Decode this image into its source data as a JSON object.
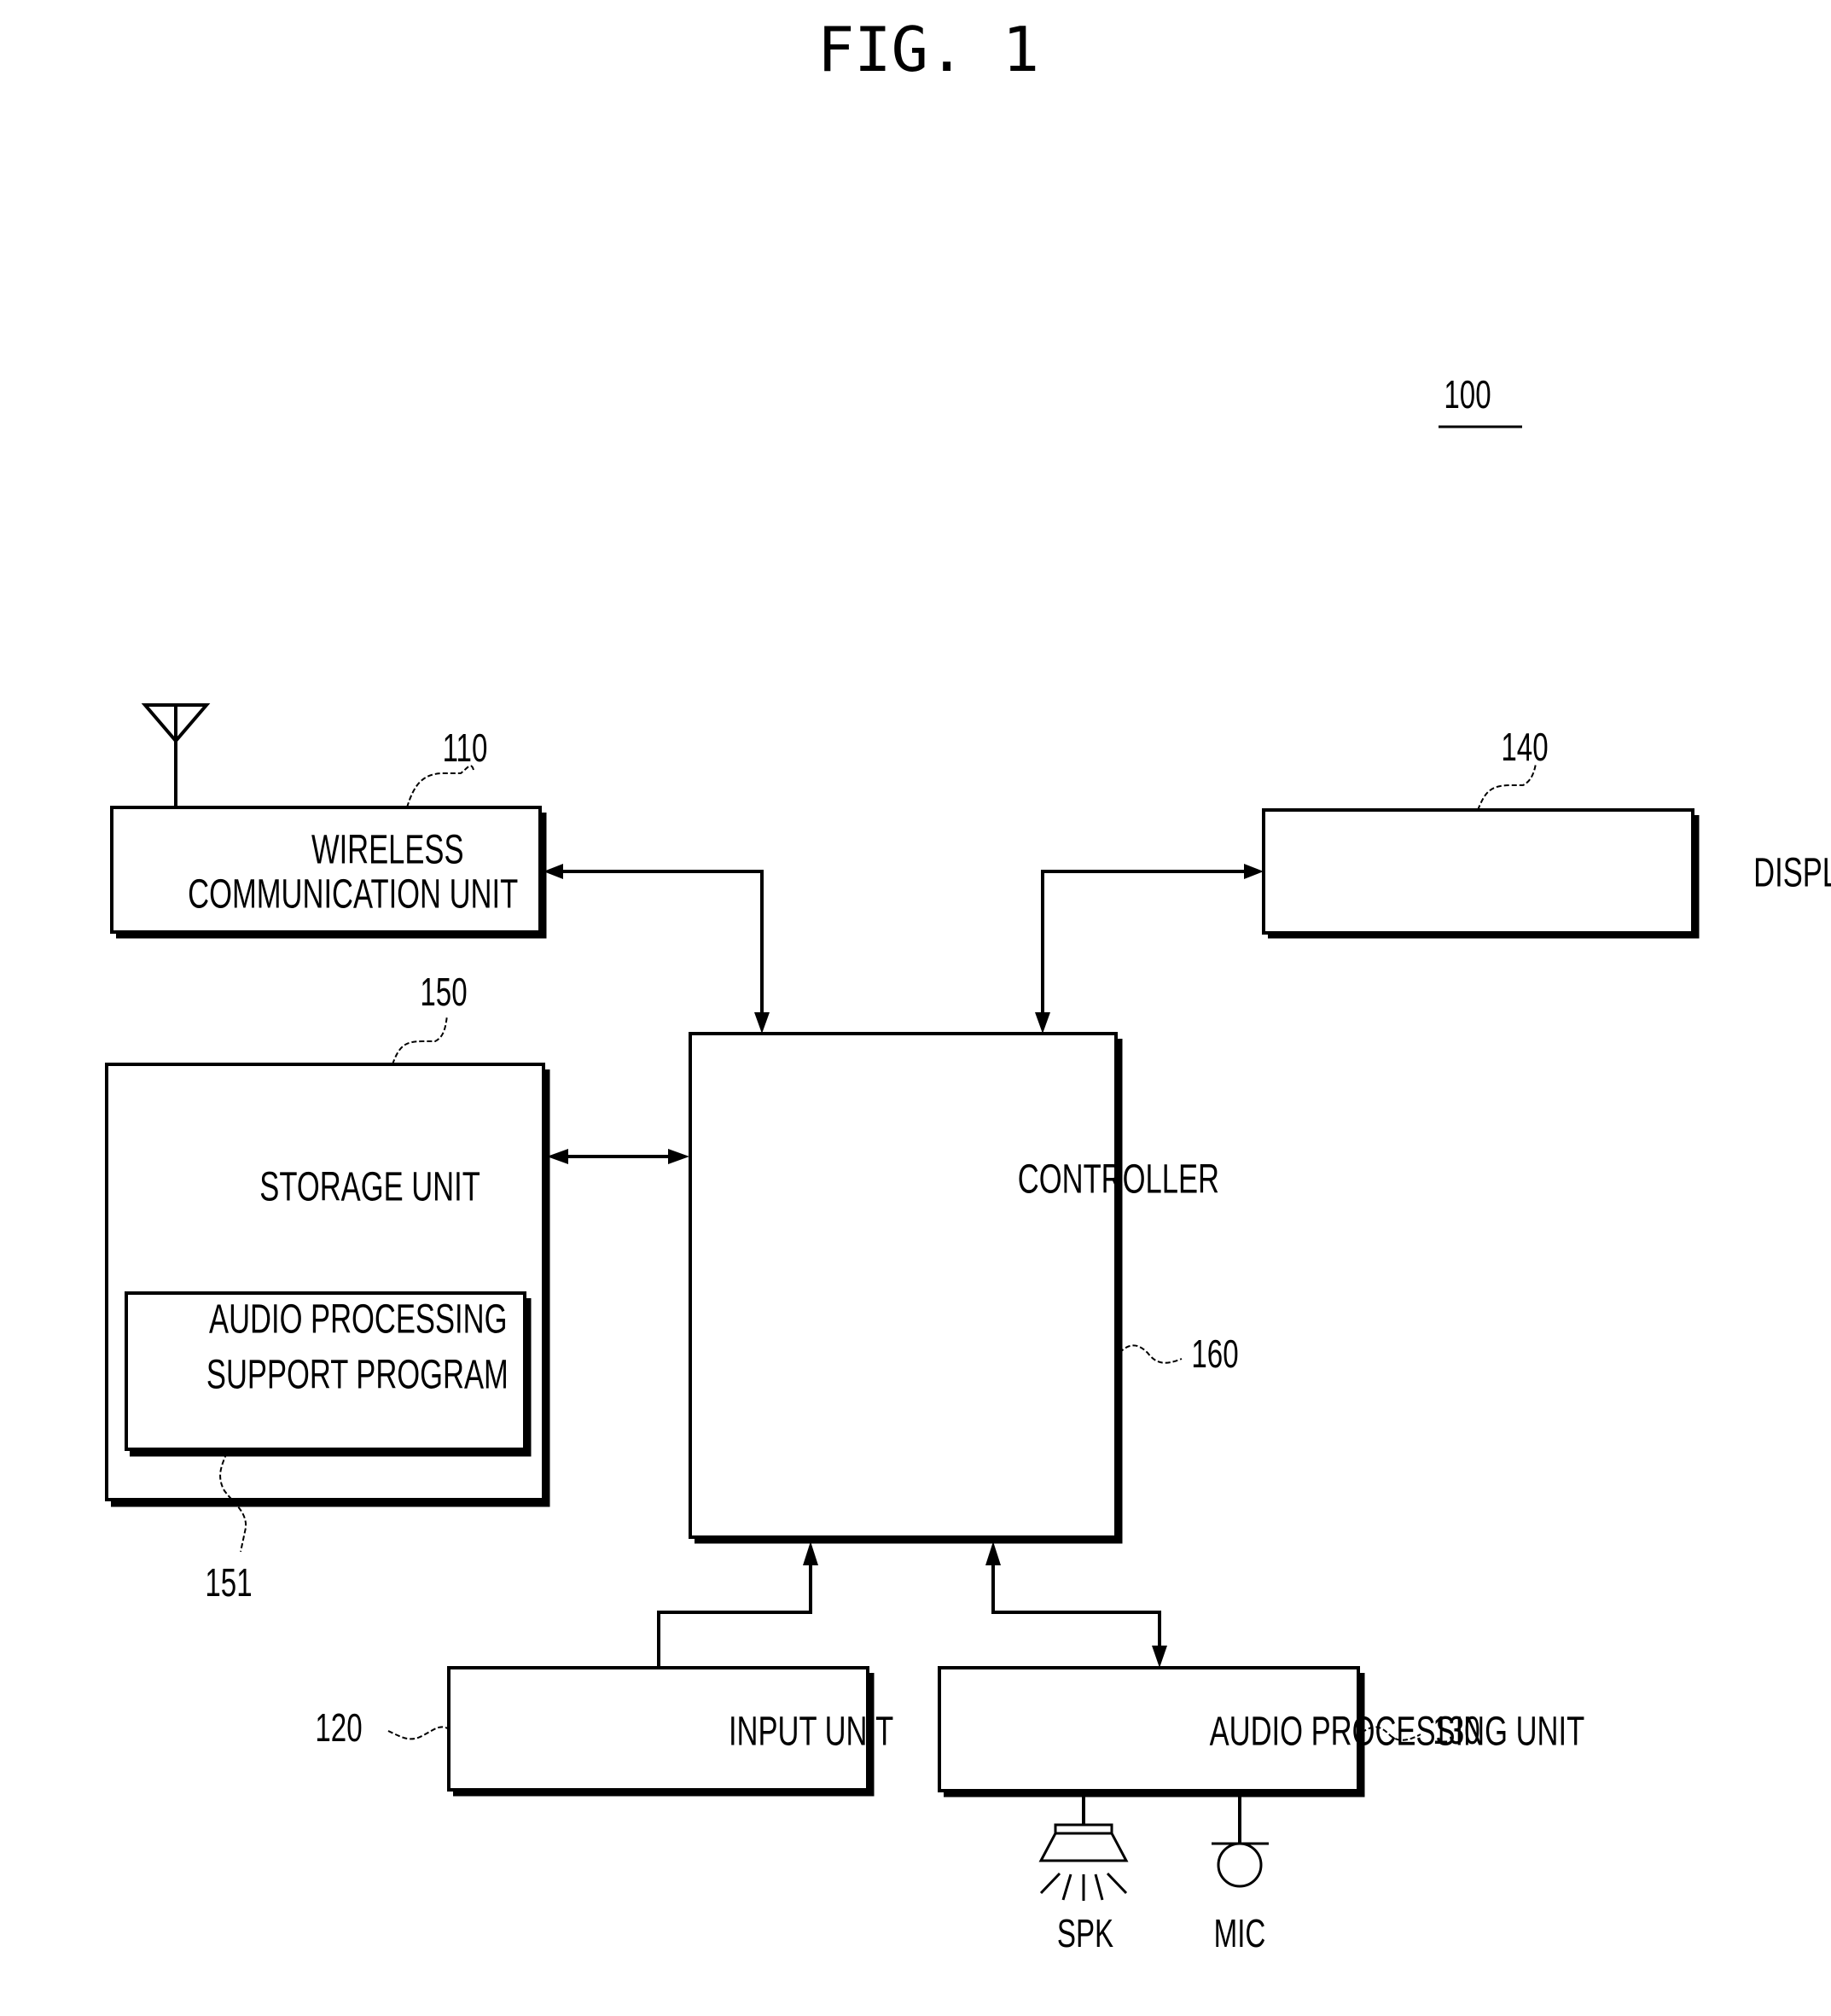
{
  "figure": {
    "title": "FIG. 1",
    "device_ref": "100"
  },
  "blocks": {
    "wireless": {
      "ref": "110",
      "lines": [
        "WIRELESS",
        "COMMUNICATION UNIT"
      ]
    },
    "display": {
      "ref": "140",
      "lines": [
        "DISPLAY UNIT"
      ]
    },
    "storage": {
      "ref": "150",
      "lines": [
        "STORAGE UNIT"
      ]
    },
    "program": {
      "ref": "151",
      "lines": [
        "AUDIO PROCESSING",
        "SUPPORT PROGRAM"
      ]
    },
    "controller": {
      "ref": "160",
      "lines": [
        "CONTROLLER"
      ]
    },
    "input": {
      "ref": "120",
      "lines": [
        "INPUT UNIT"
      ]
    },
    "audio": {
      "ref": "130",
      "lines": [
        "AUDIO PROCESSING UNIT"
      ]
    }
  },
  "peripherals": {
    "speaker": {
      "label": "SPK",
      "icon": "speaker-icon"
    },
    "microphone": {
      "label": "MIC",
      "icon": "microphone-icon"
    },
    "antenna": {
      "icon": "antenna-icon"
    }
  },
  "connections": [
    {
      "from": "wireless",
      "to": "controller",
      "direction": "bidirectional"
    },
    {
      "from": "display",
      "to": "controller",
      "direction": "bidirectional"
    },
    {
      "from": "storage",
      "to": "controller",
      "direction": "bidirectional"
    },
    {
      "from": "input",
      "to": "controller",
      "direction": "to-controller"
    },
    {
      "from": "audio",
      "to": "controller",
      "direction": "bidirectional"
    }
  ]
}
